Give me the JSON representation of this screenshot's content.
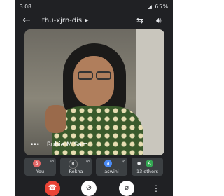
{
  "status_bar": {
    "time": "3:08",
    "battery": "65%"
  },
  "app_bar": {
    "meeting_code": "thu-xjrn-dis"
  },
  "main_video": {
    "speaker_name": "Rubie M Sam"
  },
  "participants": [
    {
      "initial": "S",
      "label": "You",
      "color": "#e06666"
    },
    {
      "initial": "R",
      "label": "Rekha",
      "color": "#3c4043"
    },
    {
      "initial": "a",
      "label": "aswini",
      "color": "#4a8af4"
    },
    {
      "initial": "A",
      "label": "13 others",
      "color": "#34a853"
    }
  ],
  "icons": {
    "back": "arrow-left-icon",
    "switch_camera": "switch-camera-icon",
    "speaker": "speaker-icon",
    "end_call": "end-call-icon",
    "camera_off": "camera-off-icon",
    "mic_off": "mic-off-icon",
    "more": "more-vertical-icon"
  }
}
